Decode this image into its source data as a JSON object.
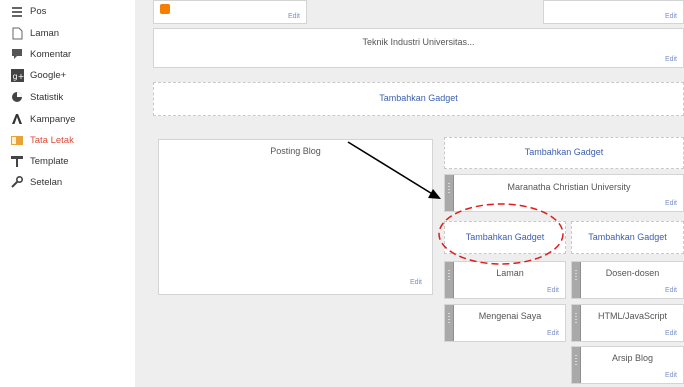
{
  "sidebar": {
    "items": [
      {
        "label": "Pos",
        "icon": "posts-icon"
      },
      {
        "label": "Laman",
        "icon": "page-icon"
      },
      {
        "label": "Komentar",
        "icon": "comment-icon"
      },
      {
        "label": "Google+",
        "icon": "google-plus-icon"
      },
      {
        "label": "Statistik",
        "icon": "stats-icon"
      },
      {
        "label": "Kampanye",
        "icon": "campaign-icon"
      },
      {
        "label": "Tata Letak",
        "icon": "layout-icon",
        "active": true
      },
      {
        "label": "Template",
        "icon": "template-icon"
      },
      {
        "label": "Setelan",
        "icon": "settings-icon"
      }
    ]
  },
  "layout": {
    "top_left_edit": "Edit",
    "top_right_edit": "Edit",
    "header_title": "Teknik Industri Universitas...",
    "header_edit": "Edit",
    "add_gadget_top": "Tambahkan Gadget",
    "main_title": "Posting Blog",
    "main_edit": "Edit",
    "sidebar_add_gadget": "Tambahkan Gadget",
    "sidebar_gadget_title": "Maranatha Christian University",
    "sidebar_gadget_edit": "Edit",
    "left_col_add_gadget": "Tambahkan Gadget",
    "right_col_add_gadget": "Tambahkan Gadget",
    "left_gadgets": [
      {
        "title": "Laman",
        "edit": "Edit"
      },
      {
        "title": "Mengenai Saya",
        "edit": "Edit"
      }
    ],
    "right_gadgets": [
      {
        "title": "Dosen-dosen",
        "edit": "Edit"
      },
      {
        "title": "HTML/JavaScript",
        "edit": "Edit"
      },
      {
        "title": "Arsip Blog",
        "edit": "Edit"
      }
    ]
  },
  "colors": {
    "accent_link": "#3b5fad",
    "active_nav": "#dd4b39",
    "annotation_circle": "#e01b1b",
    "annotation_arrow": "#000000"
  }
}
